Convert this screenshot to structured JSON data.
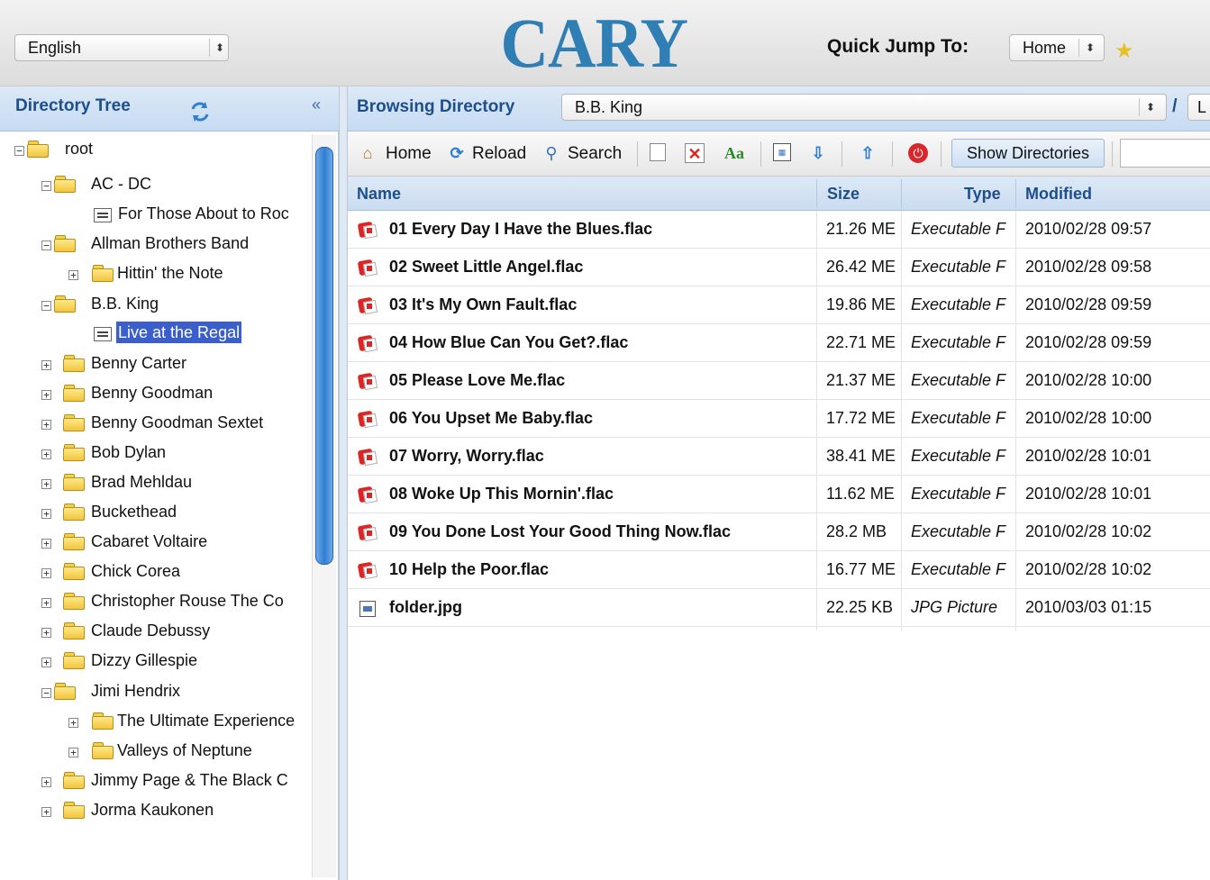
{
  "header": {
    "language": "English",
    "logo": "CARY",
    "quick_jump_label": "Quick Jump To:",
    "quick_jump_value": "Home",
    "favorite_icon": "star-icon"
  },
  "left_panel": {
    "title": "Directory Tree",
    "refresh_icon": "refresh-icon",
    "collapse_glyph": "«",
    "nodes": [
      {
        "label": "root",
        "expanded": true
      },
      {
        "label": "AC - DC",
        "expanded": true
      },
      {
        "label": "For Those About to Roc",
        "type": "album"
      },
      {
        "label": "Allman Brothers Band",
        "expanded": true
      },
      {
        "label": "Hittin' the Note",
        "expanded": false
      },
      {
        "label": "B.B. King",
        "expanded": true
      },
      {
        "label": "Live at the Regal",
        "type": "album",
        "selected": true
      },
      {
        "label": "Benny Carter",
        "expanded": false
      },
      {
        "label": "Benny Goodman",
        "expanded": false
      },
      {
        "label": "Benny Goodman Sextet",
        "expanded": false
      },
      {
        "label": "Bob Dylan",
        "expanded": false
      },
      {
        "label": "Brad Mehldau",
        "expanded": false
      },
      {
        "label": "Buckethead",
        "expanded": false
      },
      {
        "label": "Cabaret Voltaire",
        "expanded": false
      },
      {
        "label": "Chick Corea",
        "expanded": false
      },
      {
        "label": "Christopher Rouse The Co",
        "expanded": false
      },
      {
        "label": "Claude Debussy",
        "expanded": false
      },
      {
        "label": "Dizzy Gillespie",
        "expanded": false
      },
      {
        "label": "Jimi Hendrix",
        "expanded": true
      },
      {
        "label": "The Ultimate Experience",
        "expanded": false
      },
      {
        "label": "Valleys of Neptune",
        "expanded": false
      },
      {
        "label": "Jimmy Page & The Black C",
        "expanded": false
      },
      {
        "label": "Jorma Kaukonen",
        "expanded": false
      }
    ]
  },
  "right_panel": {
    "title": "Browsing Directory",
    "path_value": "B.B. King",
    "path_sep": "/",
    "path_next": "L",
    "toolbar": {
      "home": "Home",
      "reload": "Reload",
      "search": "Search",
      "show_directories": "Show Directories"
    },
    "columns": {
      "name": "Name",
      "size": "Size",
      "type": "Type",
      "modified": "Modified"
    },
    "files": [
      {
        "name": "01 Every Day I Have the Blues.flac",
        "size": "21.26 ME",
        "type": "Executable F",
        "modified": "2010/02/28 09:57",
        "icon": "flac"
      },
      {
        "name": "02 Sweet Little Angel.flac",
        "size": "26.42 ME",
        "type": "Executable F",
        "modified": "2010/02/28 09:58",
        "icon": "flac"
      },
      {
        "name": "03 It's My Own Fault.flac",
        "size": "19.86 ME",
        "type": "Executable F",
        "modified": "2010/02/28 09:59",
        "icon": "flac"
      },
      {
        "name": "04 How Blue Can You Get?.flac",
        "size": "22.71 ME",
        "type": "Executable F",
        "modified": "2010/02/28 09:59",
        "icon": "flac"
      },
      {
        "name": "05 Please Love Me.flac",
        "size": "21.37 ME",
        "type": "Executable F",
        "modified": "2010/02/28 10:00",
        "icon": "flac"
      },
      {
        "name": "06 You Upset Me Baby.flac",
        "size": "17.72 ME",
        "type": "Executable F",
        "modified": "2010/02/28 10:00",
        "icon": "flac"
      },
      {
        "name": "07 Worry, Worry.flac",
        "size": "38.41 ME",
        "type": "Executable F",
        "modified": "2010/02/28 10:01",
        "icon": "flac"
      },
      {
        "name": "08 Woke Up This Mornin'.flac",
        "size": "11.62 ME",
        "type": "Executable F",
        "modified": "2010/02/28 10:01",
        "icon": "flac"
      },
      {
        "name": "09 You Done Lost Your Good Thing Now.flac",
        "size": "28.2 MB",
        "type": "Executable F",
        "modified": "2010/02/28 10:02",
        "icon": "flac"
      },
      {
        "name": "10 Help the Poor.flac",
        "size": "16.77 ME",
        "type": "Executable F",
        "modified": "2010/02/28 10:02",
        "icon": "flac"
      },
      {
        "name": "folder.jpg",
        "size": "22.25 KB",
        "type": "JPG Picture",
        "modified": "2010/03/03 01:15",
        "icon": "jpg"
      }
    ]
  }
}
